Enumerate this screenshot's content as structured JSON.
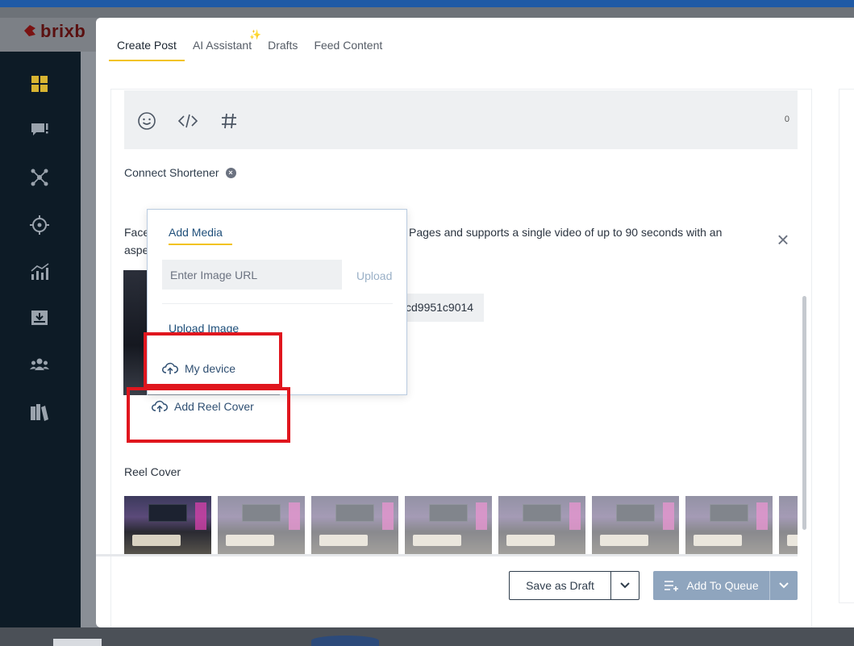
{
  "app": {
    "logo_text": "brixb"
  },
  "tabs": [
    {
      "label": "Create Post",
      "active": true
    },
    {
      "label": "AI Assistant",
      "sparkle": "✨"
    },
    {
      "label": "Drafts"
    },
    {
      "label": "Feed Content"
    }
  ],
  "editor": {
    "char_count": "0",
    "connect_shortener": "Connect Shortener",
    "description_line1_left": "Face",
    "description_line1_right": "Pages and supports a single video of up to 90 seconds with an",
    "description_line2_left": "aspe",
    "media_hash": "cd9951c9014"
  },
  "popover": {
    "tab_label": "Add Media",
    "url_placeholder": "Enter Image URL",
    "upload_label": "Upload",
    "upload_image_label": "Upload Image",
    "my_device_label": "My device"
  },
  "add_reel_cover_label": "Add Reel Cover",
  "reel_cover": {
    "label": "Reel Cover",
    "thumbnails": [
      {
        "selected": true
      },
      {
        "selected": false
      },
      {
        "selected": false
      },
      {
        "selected": false
      },
      {
        "selected": false
      },
      {
        "selected": false
      },
      {
        "selected": false
      },
      {
        "selected": false
      }
    ]
  },
  "footer": {
    "save_draft_label": "Save as Draft",
    "add_queue_label": "Add To Queue"
  },
  "colors": {
    "accent_yellow": "#f2c318",
    "sidebar_bg": "#0d1b26",
    "highlight_red": "#e0161e",
    "queue_button": "#8fa5be"
  },
  "sidebar": {
    "items": [
      {
        "icon": "dashboard-icon"
      },
      {
        "icon": "chat-alert-icon"
      },
      {
        "icon": "network-icon"
      },
      {
        "icon": "target-icon"
      },
      {
        "icon": "analytics-icon"
      },
      {
        "icon": "inbox-icon"
      },
      {
        "icon": "team-icon"
      },
      {
        "icon": "library-icon"
      }
    ]
  }
}
